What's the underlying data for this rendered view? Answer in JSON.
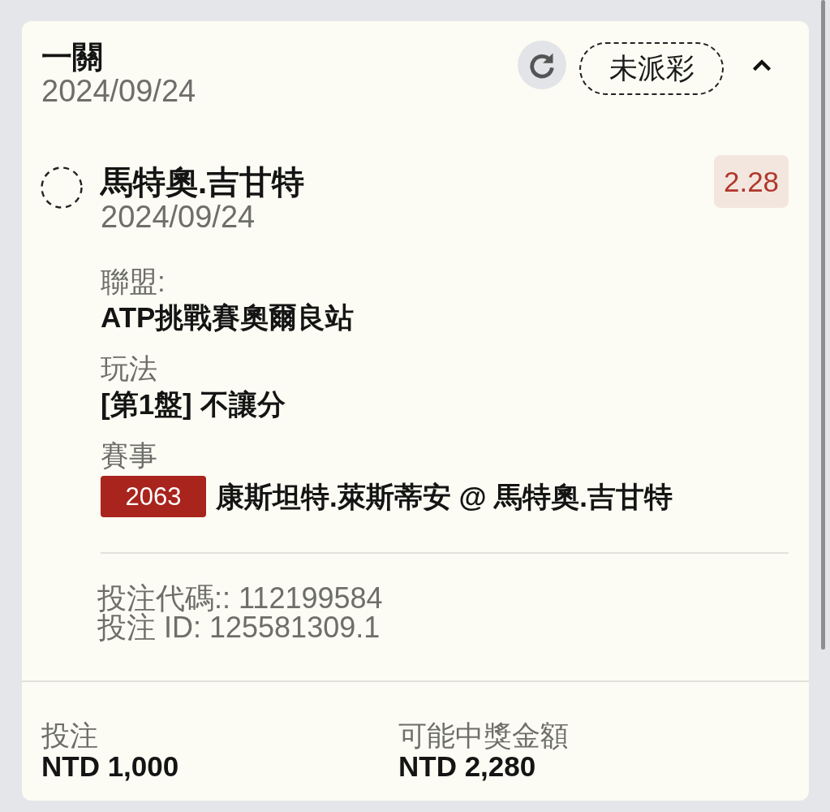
{
  "ticket": {
    "title": "一關",
    "date": "2024/09/24",
    "status": "未派彩",
    "expanded": true
  },
  "selections": [
    {
      "name": "馬特奧.吉甘特",
      "date": "2024/09/24",
      "odds": "2.28",
      "settled": false,
      "details": [
        {
          "kind": "text",
          "label": "聯盟:",
          "value": "ATP挑戰賽奧爾良站"
        },
        {
          "kind": "text",
          "label": "玩法",
          "value": "[第1盤] 不讓分"
        },
        {
          "kind": "event",
          "label": "賽事",
          "code": "2063",
          "value": "康斯坦特.萊斯蒂安 @ 馬特奧.吉甘特"
        }
      ],
      "bet_codes": [
        "投注代碼:: 112199584",
        "投注 ID: 125581309.1"
      ]
    }
  ],
  "footer": [
    {
      "label": "投注",
      "value": "NTD 1,000"
    },
    {
      "label": "可能中獎金額",
      "value": "NTD 2,280"
    }
  ]
}
